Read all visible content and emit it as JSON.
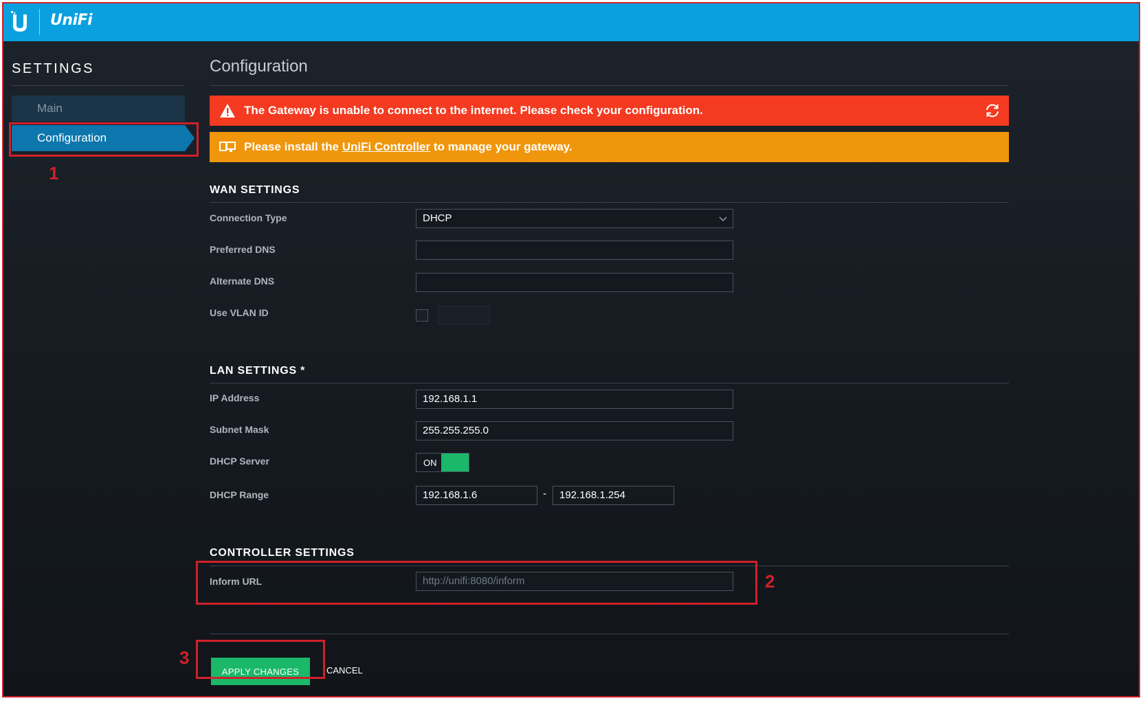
{
  "app": {
    "brand": "UniFi",
    "colors": {
      "topbar": "#0aa0e0",
      "alert_error": "#f43a20",
      "alert_warning": "#f0960c",
      "toggle_on": "#1bb86a",
      "annotation": "#d0202a"
    }
  },
  "sidebar": {
    "title": "SETTINGS",
    "items": [
      {
        "label": "Main",
        "active": false
      },
      {
        "label": "Configuration",
        "active": true
      }
    ]
  },
  "main": {
    "title": "Configuration",
    "alerts": {
      "error": {
        "icon": "warning-triangle-icon",
        "text": "The Gateway is unable to connect to the internet. Please check your configuration.",
        "action_icon": "refresh-icon"
      },
      "warning": {
        "icon": "monitor-icon",
        "prefix": "Please install the ",
        "link": "UniFi Controller",
        "suffix": " to manage your gateway."
      }
    },
    "wan": {
      "title": "WAN SETTINGS",
      "connection_type_label": "Connection Type",
      "connection_type_value": "DHCP",
      "preferred_dns_label": "Preferred DNS",
      "preferred_dns_value": "",
      "alternate_dns_label": "Alternate DNS",
      "alternate_dns_value": "",
      "vlan_label": "Use VLAN ID",
      "vlan_checked": false,
      "vlan_value": ""
    },
    "lan": {
      "title": "LAN SETTINGS *",
      "ip_label": "IP Address",
      "ip_value": "192.168.1.1",
      "subnet_label": "Subnet Mask",
      "subnet_value": "255.255.255.0",
      "dhcp_server_label": "DHCP Server",
      "dhcp_server_state": "ON",
      "dhcp_range_label": "DHCP Range",
      "dhcp_range_start": "192.168.1.6",
      "dhcp_range_separator": "-",
      "dhcp_range_end": "192.168.1.254"
    },
    "controller": {
      "title": "CONTROLLER SETTINGS",
      "inform_url_label": "Inform URL",
      "inform_url_placeholder": "http://unifi:8080/inform"
    },
    "actions": {
      "apply": "APPLY CHANGES",
      "cancel": "CANCEL"
    }
  },
  "annotations": [
    "1",
    "2",
    "3"
  ]
}
